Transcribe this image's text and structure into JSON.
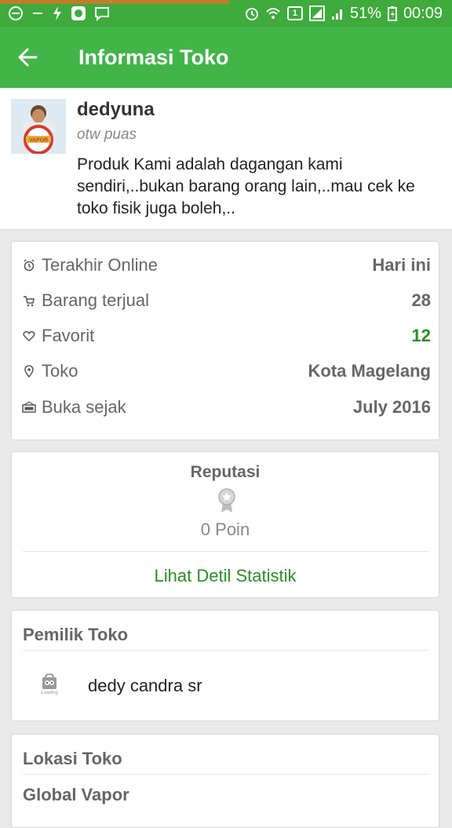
{
  "status_bar": {
    "battery": "51%",
    "time": "00:09",
    "sim": "1"
  },
  "toolbar": {
    "title": "Informasi Toko"
  },
  "profile": {
    "name": "dedyuna",
    "tagline": "otw puas",
    "description": "Produk Kami adalah dagangan kami sendiri,..bukan barang orang lain,..mau cek ke toko fisik juga boleh,..",
    "avatar_text": "VAPOR"
  },
  "info": [
    {
      "icon": "alarm-clock-icon",
      "label": "Terakhir Online",
      "value": "Hari ini"
    },
    {
      "icon": "cart-icon",
      "label": "Barang terjual",
      "value": "28"
    },
    {
      "icon": "heart-icon",
      "label": "Favorit",
      "value": "12"
    },
    {
      "icon": "location-pin-icon",
      "label": "Toko",
      "value": "Kota Magelang"
    },
    {
      "icon": "open-sign-icon",
      "label": "Buka sejak",
      "value": "July 2016"
    }
  ],
  "reputation": {
    "title": "Reputasi",
    "points": "0 Poin",
    "link": "Lihat Detil Statistik"
  },
  "owner": {
    "title": "Pemilik Toko",
    "name": "dedy candra sr",
    "logo_caption": "Loading"
  },
  "location": {
    "title": "Lokasi Toko",
    "name": "Global Vapor"
  },
  "colors": {
    "primary": "#42b549",
    "status_bar": "#3eab3c",
    "accent_green": "#2a8f25"
  }
}
